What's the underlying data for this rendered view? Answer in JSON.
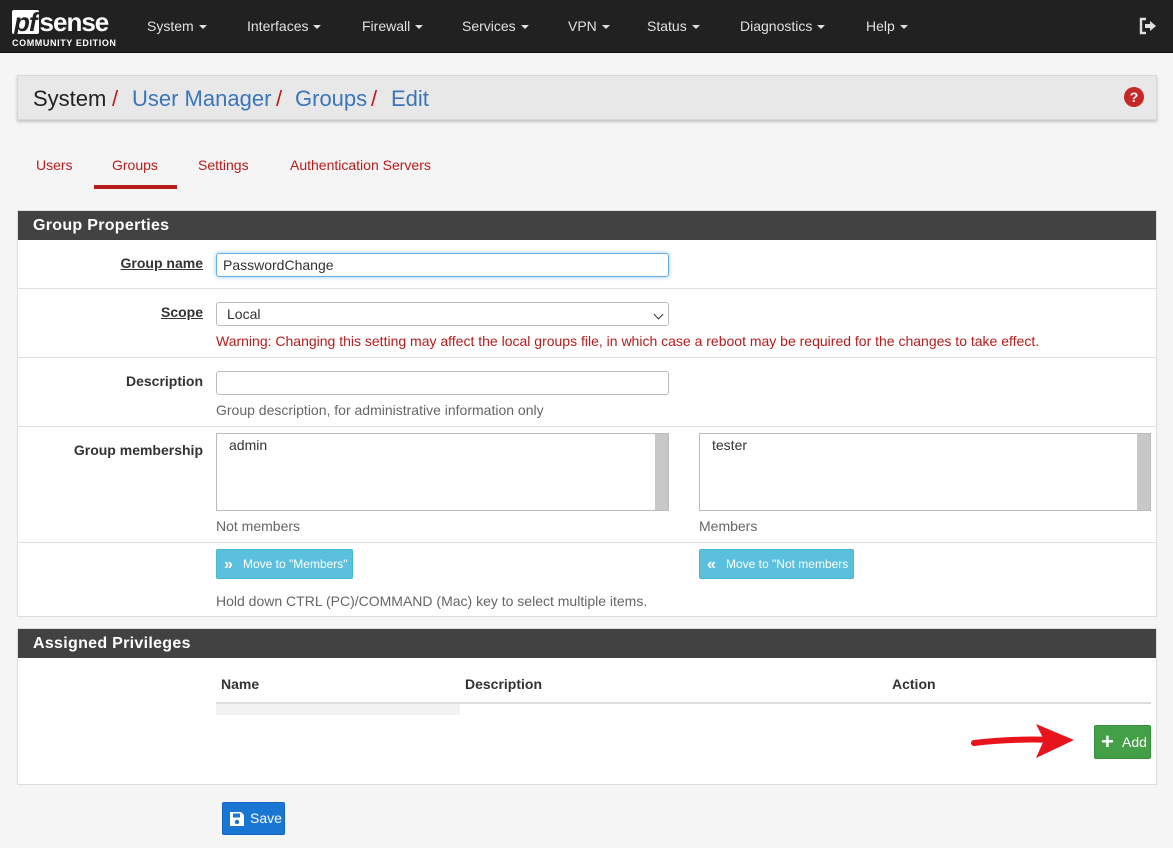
{
  "brand": {
    "logo_pf": "pf",
    "logo_sense": "sense",
    "logo_sub": "COMMUNITY EDITION"
  },
  "nav": {
    "items": [
      {
        "label": "System"
      },
      {
        "label": "Interfaces"
      },
      {
        "label": "Firewall"
      },
      {
        "label": "Services"
      },
      {
        "label": "VPN"
      },
      {
        "label": "Status"
      },
      {
        "label": "Diagnostics"
      },
      {
        "label": "Help"
      }
    ]
  },
  "breadcrumb": {
    "root": "System",
    "items": [
      {
        "label": "User Manager"
      },
      {
        "label": "Groups"
      },
      {
        "label": "Edit"
      }
    ],
    "separator": "/"
  },
  "tabs": [
    {
      "label": "Users",
      "active": false
    },
    {
      "label": "Groups",
      "active": true
    },
    {
      "label": "Settings",
      "active": false
    },
    {
      "label": "Authentication Servers",
      "active": false
    }
  ],
  "group_properties": {
    "title": "Group Properties",
    "group_name": {
      "label": "Group name",
      "value": "PasswordChange"
    },
    "scope": {
      "label": "Scope",
      "value": "Local",
      "warning": "Warning: Changing this setting may affect the local groups file, in which case a reboot may be required for the changes to take effect."
    },
    "description": {
      "label": "Description",
      "value": "",
      "help": "Group description, for administrative information only"
    },
    "membership": {
      "label": "Group membership",
      "not_members": [
        "admin"
      ],
      "not_members_label": "Not members",
      "members": [
        "tester"
      ],
      "members_label": "Members",
      "move_to_members": "Move to \"Members\"",
      "move_to_not_members": "Move to \"Not members",
      "help": "Hold down CTRL (PC)/COMMAND (Mac) key to select multiple items."
    }
  },
  "assigned_privileges": {
    "title": "Assigned Privileges",
    "columns": [
      "Name",
      "Description",
      "Action"
    ],
    "add_label": "Add"
  },
  "save_label": "Save",
  "colors": {
    "navbar": "#212121",
    "accent_red": "#b71c1c",
    "link_blue": "#3a76b8",
    "info": "#5bc0de",
    "success": "#43a047",
    "primary": "#1976d2",
    "annotation_arrow": "#e8141c"
  },
  "icons": {
    "logout": "sign-out-icon",
    "help": "question-circle-icon",
    "move_right": "double-chevron-right-icon",
    "move_left": "double-chevron-left-icon",
    "add": "plus-icon",
    "save": "floppy-disk-icon"
  }
}
